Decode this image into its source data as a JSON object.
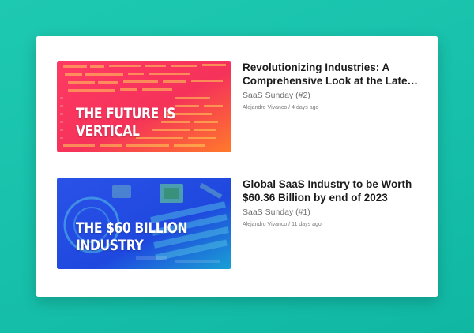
{
  "posts": [
    {
      "thumb_lines": [
        "THE FUTURE IS",
        "VERTICAL"
      ],
      "title_lines": [
        "Revolutionizing Industries: A",
        "Comprehensive Look at the Latest..."
      ],
      "series": "SaaS Sunday (#2)",
      "author": "Alejandro Vivanco",
      "separator": " / ",
      "date": "4 days ago",
      "thumb_colors": [
        "#ff2d5e",
        "#ff7a2a"
      ]
    },
    {
      "thumb_lines": [
        "THE $60 BILLION",
        "INDUSTRY"
      ],
      "title_lines": [
        "Global SaaS Industry to be Worth",
        "$60.36 Billion by end of 2023"
      ],
      "series": "SaaS Sunday (#1)",
      "author": "Alejandro Vivanco",
      "separator": " / ",
      "date": "11 days ago",
      "thumb_colors": [
        "#1f4fe6",
        "#0f9bd6"
      ]
    }
  ]
}
